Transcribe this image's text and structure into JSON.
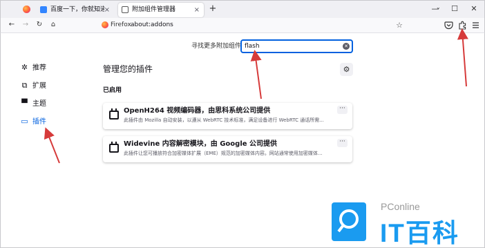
{
  "browser": {
    "tabs": [
      {
        "label": "百度一下，你就知道",
        "close": "×"
      },
      {
        "label": "附加组件管理器",
        "close": "×"
      }
    ],
    "new_tab": "+",
    "window_controls": {
      "minimize": "—",
      "maximize": "☐",
      "close": "✕"
    },
    "tabs_menu": "⌄",
    "nav": {
      "back": "←",
      "forward": "→",
      "reload": "↻",
      "home": "⌂"
    },
    "url_identity": "Firefox",
    "url": "about:addons",
    "bookmark_star": "☆",
    "toolbar_icons": [
      "pocket-icon",
      "extensions-icon",
      "menu-icon"
    ]
  },
  "addons": {
    "search_label": "寻找更多附加组件",
    "search_value": "flash",
    "sidebar": [
      {
        "icon": "recommendations-icon",
        "label": "推荐",
        "active": false
      },
      {
        "icon": "extensions-icon",
        "label": "扩展",
        "active": false
      },
      {
        "icon": "themes-icon",
        "label": "主题",
        "active": false
      },
      {
        "icon": "plugins-icon",
        "label": "插件",
        "active": true
      }
    ],
    "title": "管理您的插件",
    "section": "已启用",
    "plugins": [
      {
        "name": "OpenH264 视频编码器，由思科系统公司提供",
        "description": "此插件由 Mozilla 自动安装，以遵从 WebRTC 技术标准，满足设备进行 WebRTC 通话所需..."
      },
      {
        "name": "Widevine 内容解密模块，由 Google 公司提供",
        "description": "此插件让您可播放符合加密媒体扩展（EME）规范的加密媒体内容。网站通常使用加密媒体..."
      }
    ]
  },
  "watermark": {
    "brand": "PConline",
    "name": "IT百科"
  },
  "colors": {
    "accent": "#0060df",
    "annotation": "#d63a3a",
    "watermark": "#1a9bf0"
  }
}
